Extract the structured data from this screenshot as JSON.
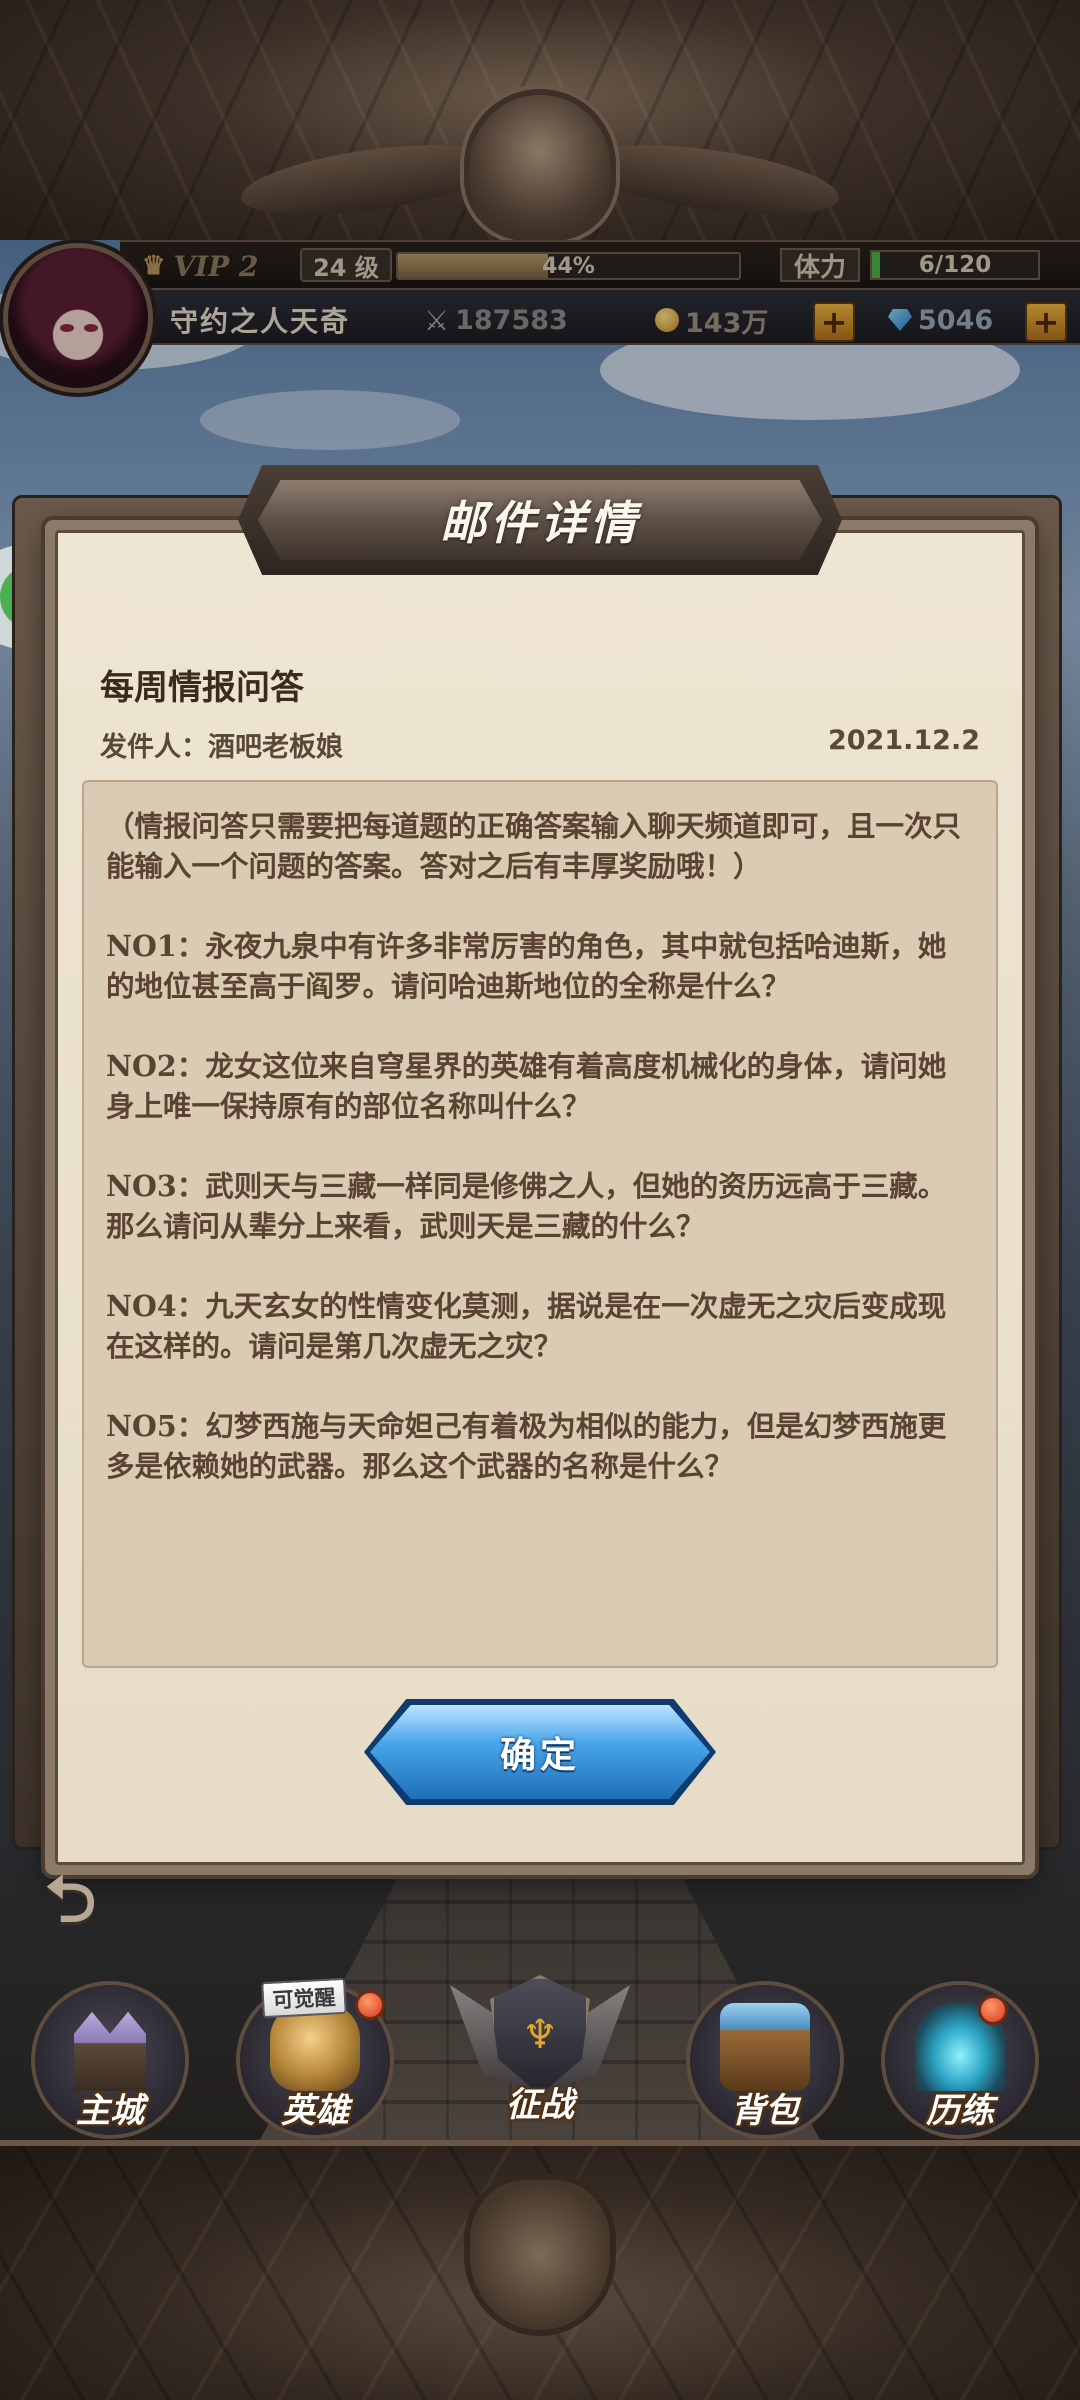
{
  "hud": {
    "vip_label": "VIP 2",
    "level": "24 级",
    "exp_percent_text": "44%",
    "exp_fraction": 0.44,
    "stamina_label": "体力",
    "stamina_text": "6/120",
    "stamina_fraction": 0.05,
    "player_name": "守约之人天奇",
    "power": "187583",
    "gold": "143万",
    "diamond": "5046",
    "plus_symbol": "+"
  },
  "floaters": {
    "chat_dots": "•••"
  },
  "modal": {
    "title": "邮件详情",
    "subject": "每周情报问答",
    "sender": "发件人：酒吧老板娘",
    "date": "2021.12.2",
    "body": [
      "（情报问答只需要把每道题的正确答案输入聊天频道即可，且一次只能输入一个问题的答案。答对之后有丰厚奖励哦！）",
      "NO1：永夜九泉中有许多非常厉害的角色，其中就包括哈迪斯，她的地位甚至高于阎罗。请问哈迪斯地位的全称是什么？",
      "NO2：龙女这位来自穹星界的英雄有着高度机械化的身体，请问她身上唯一保持原有的部位名称叫什么？",
      "NO3：武则天与三藏一样同是修佛之人，但她的资历远高于三藏。那么请问从辈分上来看，武则天是三藏的什么？",
      "NO4：九天玄女的性情变化莫测，据说是在一次虚无之灾后变成现在这样的。请问是第几次虚无之灾？",
      "NO5：幻梦西施与天命妲己有着极为相似的能力，但是幻梦西施更多是依赖她的武器。那么这个武器的名称是什么？"
    ],
    "confirm_label": "确定"
  },
  "nav": {
    "awaken_tag": "可觉醒",
    "items": [
      {
        "label": "主城",
        "icon": "castle-icon"
      },
      {
        "label": "英雄",
        "icon": "hero-helmet-icon"
      },
      {
        "label": "征战",
        "icon": "battle-shield-icon"
      },
      {
        "label": "背包",
        "icon": "backpack-chest-icon"
      },
      {
        "label": "历练",
        "icon": "portal-gate-icon"
      }
    ]
  },
  "colors": {
    "accent_gold": "#f0b640",
    "confirm_blue": "#1d6fb8",
    "parchment": "#eee5d2",
    "body_text": "#5b4331"
  }
}
